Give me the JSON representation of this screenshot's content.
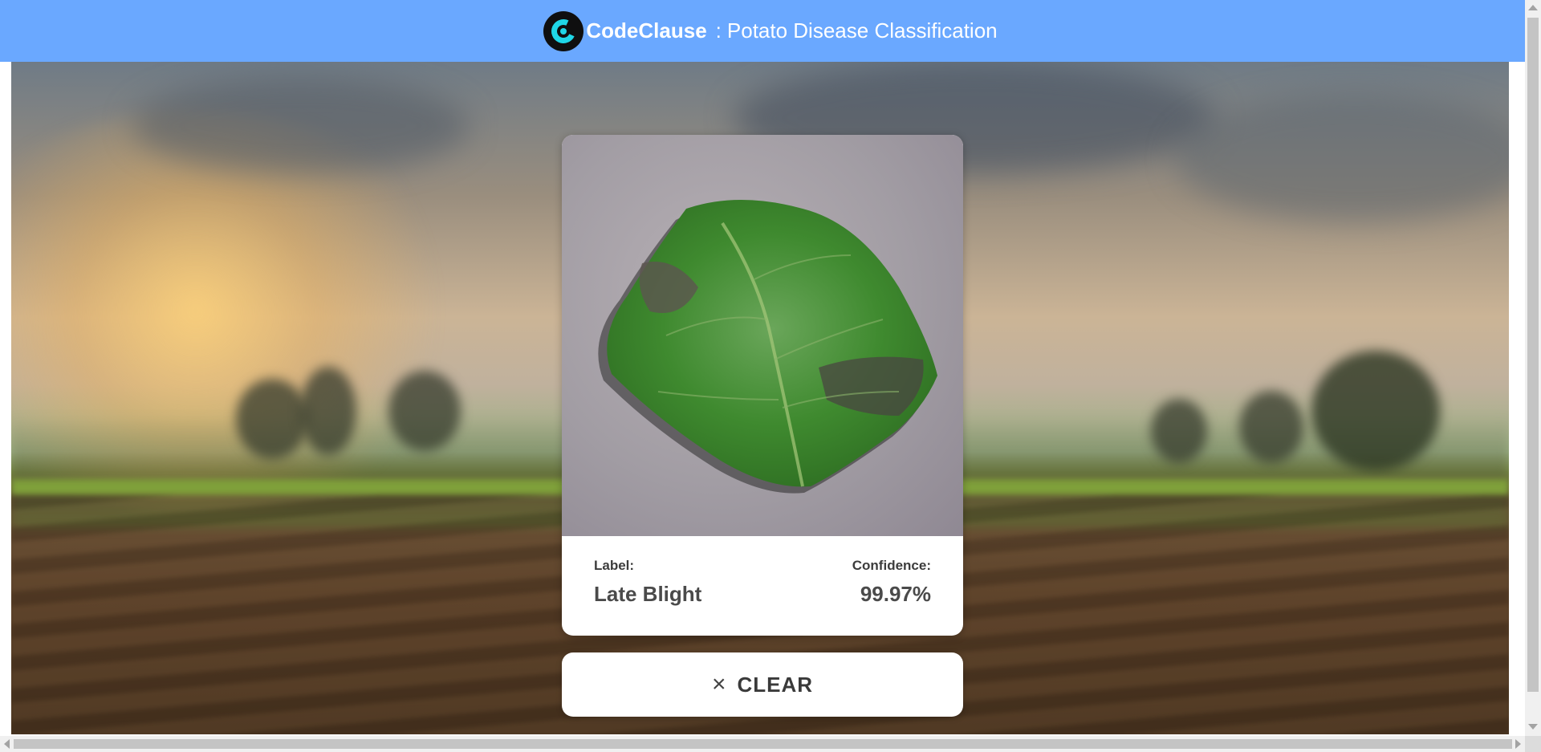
{
  "header": {
    "brand": "CodeClause",
    "separator": ":",
    "title": "Potato Disease Classification",
    "logo_icon": "codeclause-logo-icon",
    "background_color": "#6aa8ff"
  },
  "result": {
    "label_heading": "Label:",
    "label_value": "Late Blight",
    "confidence_heading": "Confidence:",
    "confidence_value": "99.97%"
  },
  "actions": {
    "clear_icon": "×",
    "clear_label": "CLEAR"
  },
  "colors": {
    "card": "#ffffff",
    "text": "#3c3c3c",
    "leaf": "#3f8a2f"
  }
}
